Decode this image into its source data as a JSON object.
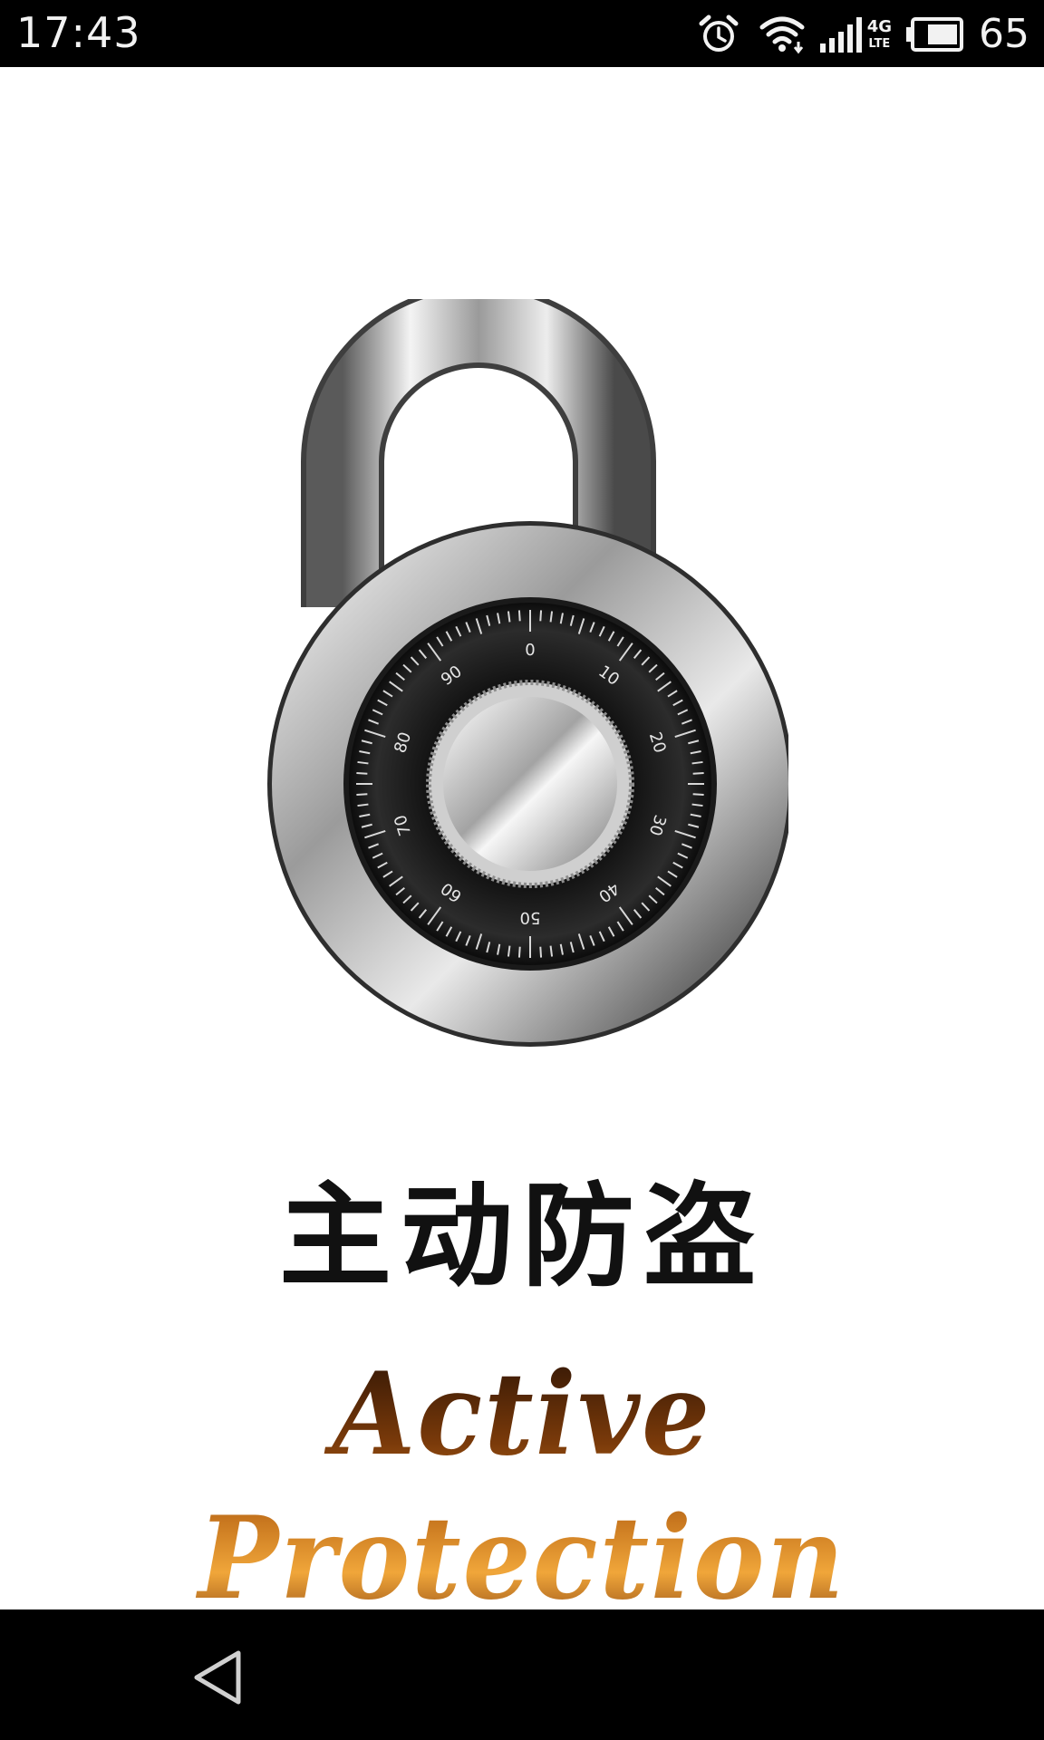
{
  "status_bar": {
    "time": "17:43",
    "battery_level": "65",
    "icons": [
      "alarm-icon",
      "wifi-icon",
      "signal-icon",
      "4g-lte-icon",
      "battery-icon"
    ],
    "network_label_top": "4G",
    "network_label_bottom": "LTE"
  },
  "lock": {
    "dial_numbers": [
      "0",
      "10",
      "20",
      "30",
      "40",
      "50",
      "60",
      "70",
      "80",
      "90"
    ]
  },
  "main": {
    "title_cn": "主动防盗",
    "title_en": "Active Protection"
  },
  "nav_bar": {
    "icons": [
      "back-icon"
    ]
  },
  "colors": {
    "status_bar": "#000000",
    "background": "#ffffff",
    "title_text": "#111111",
    "title_en_accent": "#c8771f"
  }
}
